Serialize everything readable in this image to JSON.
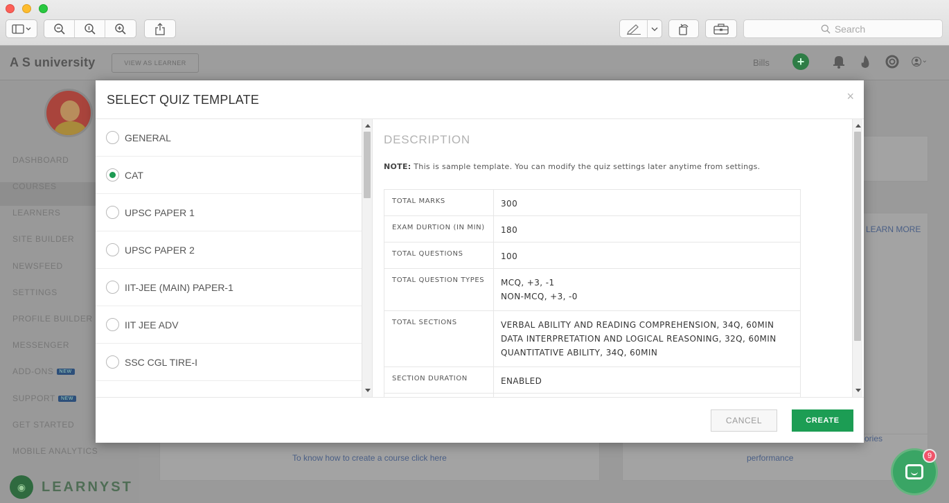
{
  "browser": {
    "search_placeholder": "Search",
    "icons": [
      "sidebar-toggle-icon",
      "zoom-out-icon",
      "zoom-reset-icon",
      "zoom-in-icon",
      "share-icon",
      "markup-icon",
      "rotate-icon",
      "toolbox-icon",
      "search-icon"
    ]
  },
  "app": {
    "title": "A S university",
    "view_button": "VIEW AS LEARNER",
    "bills": "Bills",
    "sidebar_items": [
      {
        "label": "DASHBOARD",
        "badge": ""
      },
      {
        "label": "COURSES",
        "badge": ""
      },
      {
        "label": "LEARNERS",
        "badge": ""
      },
      {
        "label": "SITE BUILDER",
        "badge": ""
      },
      {
        "label": "NEWSFEED",
        "badge": ""
      },
      {
        "label": "SETTINGS",
        "badge": ""
      },
      {
        "label": "PROFILE BUILDER",
        "badge": ""
      },
      {
        "label": "MESSENGER",
        "badge": ""
      },
      {
        "label": "ADD-ONS",
        "badge": "NEW"
      },
      {
        "label": "SUPPORT",
        "badge": "NEW"
      },
      {
        "label": "GET STARTED",
        "badge": ""
      },
      {
        "label": "MOBILE ANALYTICS",
        "badge": ""
      }
    ],
    "brand": "LEARNYST",
    "bg_link_1": "LEARN MORE",
    "bg_link_2": "To know how to create a course click here",
    "bg_link_3": "performance",
    "bg_link_4": "ories"
  },
  "modal": {
    "title": "SELECT QUIZ TEMPLATE",
    "close": "×",
    "templates": [
      {
        "label": "GENERAL",
        "checked": false
      },
      {
        "label": "CAT",
        "checked": true
      },
      {
        "label": "UPSC PAPER 1",
        "checked": false
      },
      {
        "label": "UPSC PAPER 2",
        "checked": false
      },
      {
        "label": "IIT-JEE (MAIN) PAPER-1",
        "checked": false
      },
      {
        "label": "IIT JEE ADV",
        "checked": false
      },
      {
        "label": "SSC CGL TIRE-I",
        "checked": false
      }
    ],
    "description": {
      "heading": "DESCRIPTION",
      "note_label": "NOTE:",
      "note_text": " This is sample template. You can modify the quiz settings later anytime from settings.",
      "rows": [
        {
          "key": "TOTAL MARKS",
          "value": [
            "300"
          ]
        },
        {
          "key": "EXAM DURTION (IN MIN)",
          "value": [
            "180"
          ]
        },
        {
          "key": "TOTAL QUESTIONS",
          "value": [
            "100"
          ]
        },
        {
          "key": "TOTAL QUESTION TYPES",
          "value": [
            "MCQ,   +3,   -1",
            "NON-MCQ,   +3,   -0"
          ]
        },
        {
          "key": "TOTAL SECTIONS",
          "value": [
            "VERBAL ABILITY AND READING COMPREHENSION,   34Q,   60MIN",
            "DATA INTERPRETATION AND LOGICAL REASONING,   32Q,   60MIN",
            "QUANTITATIVE ABILITY,   34Q,   60MIN"
          ]
        },
        {
          "key": "SECTION DURATION",
          "value": [
            "ENABLED"
          ]
        },
        {
          "key": "",
          "value": [
            ""
          ]
        }
      ]
    },
    "cancel_label": "CANCEL",
    "create_label": "CREATE"
  },
  "chat": {
    "badge": "9"
  },
  "colors": {
    "accent": "#1c9d54",
    "badge": "#f0546a"
  }
}
